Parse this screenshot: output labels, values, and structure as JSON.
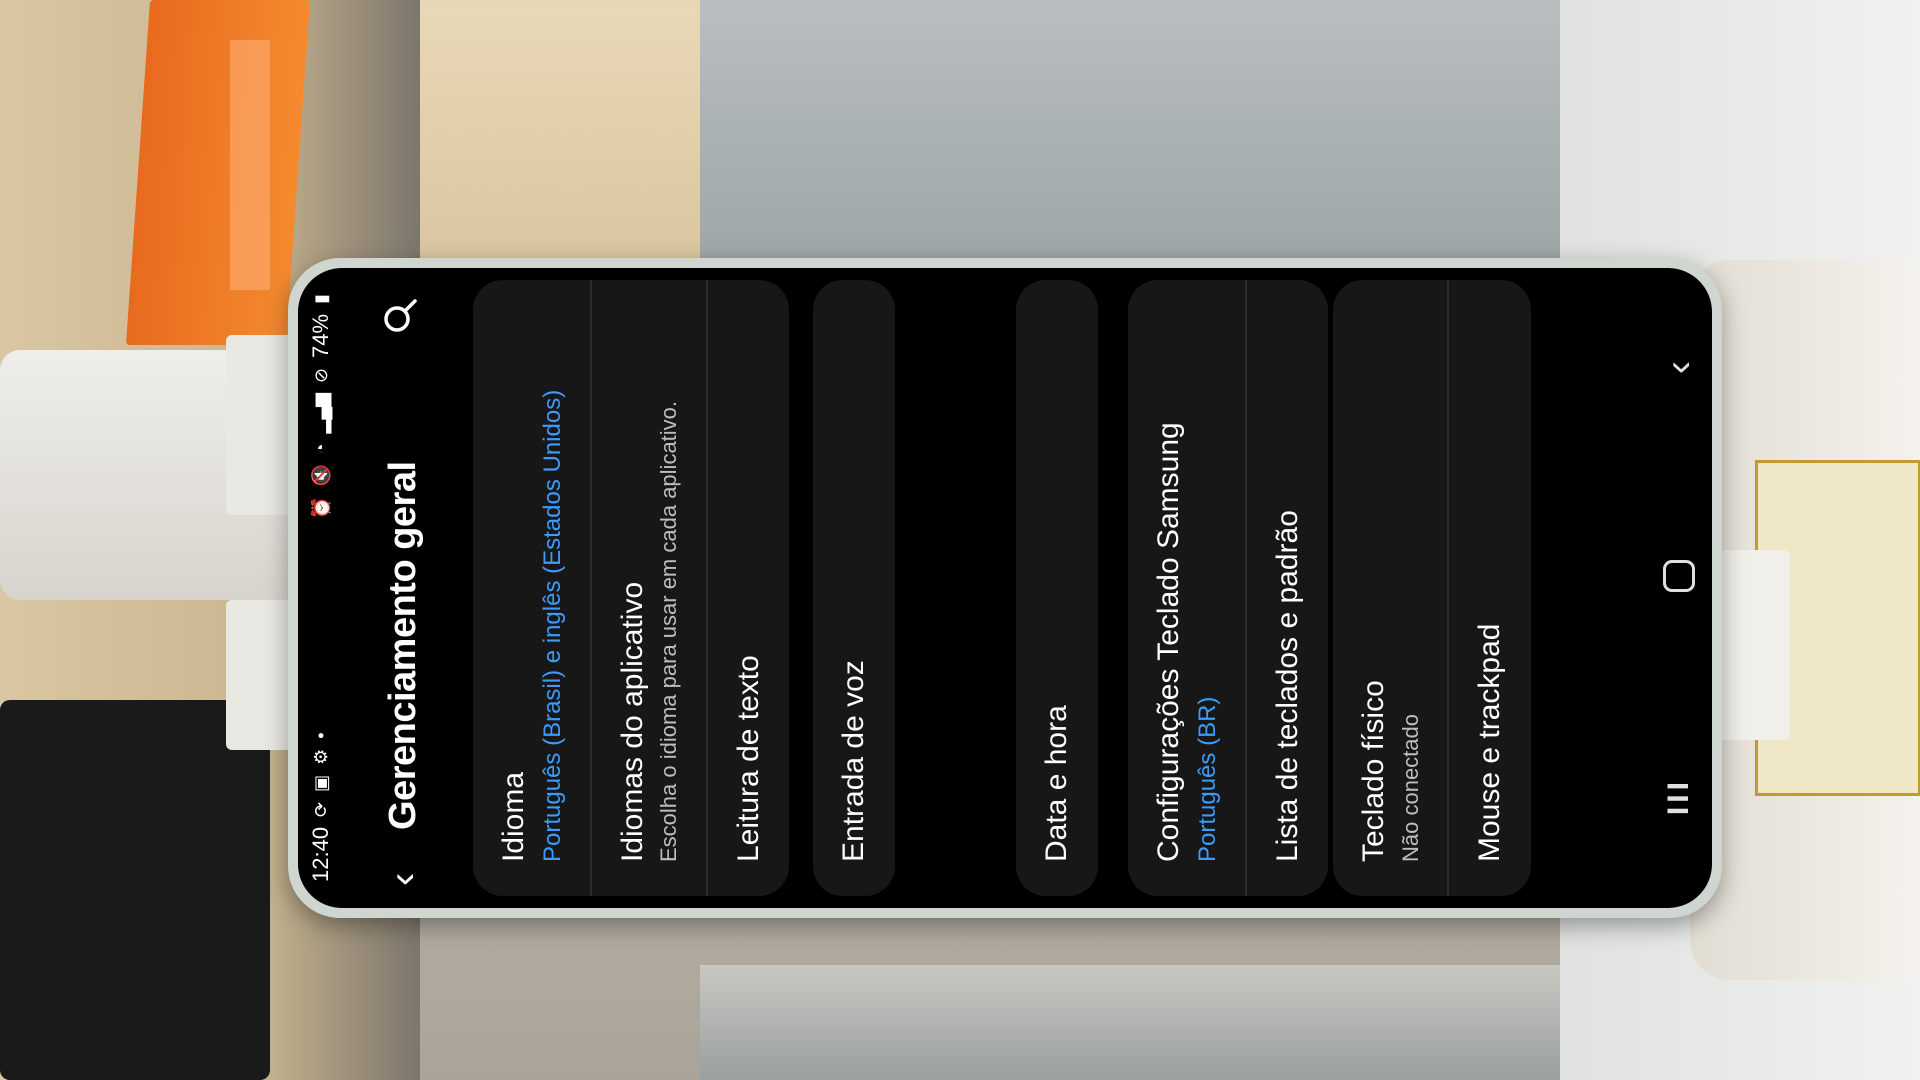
{
  "status_bar": {
    "time": "12:40",
    "battery": "74%",
    "left_icons": [
      "sync-icon",
      "image-icon",
      "gear-icon",
      "dot-icon"
    ],
    "right_icons": [
      "alarm-icon",
      "mute-icon",
      "wifi-icon",
      "signal-icon",
      "no-sign-icon"
    ]
  },
  "header": {
    "title": "Gerenciamento geral",
    "back_icon": "chevron-left-icon",
    "search_icon": "search-icon"
  },
  "sections": {
    "idioma": {
      "title": "Idioma",
      "subtitle": "Português (Brasil) e inglês (Estados Unidos)"
    },
    "idiomas_aplicativo": {
      "title": "Idiomas do aplicativo",
      "subtitle": "Escolha o idioma para usar em cada aplicativo."
    },
    "leitura_texto": {
      "title": "Leitura de texto"
    },
    "entrada_voz": {
      "title": "Entrada de voz"
    },
    "data_hora": {
      "title": "Data e hora"
    },
    "config_teclado": {
      "title": "Configurações Teclado Samsung",
      "subtitle": "Português (BR)"
    },
    "lista_teclados": {
      "title": "Lista de teclados e padrão"
    },
    "teclado_fisico": {
      "title": "Teclado físico",
      "subtitle": "Não conectado"
    },
    "mouse_trackpad": {
      "title": "Mouse e trackpad"
    }
  },
  "nav_bar": {
    "recents": "III",
    "back": "‹"
  },
  "colors": {
    "accent_blue": "#3b9bff",
    "card_bg": "#171717",
    "screen_bg": "#000000",
    "secondary_text": "#bdbdbd"
  }
}
